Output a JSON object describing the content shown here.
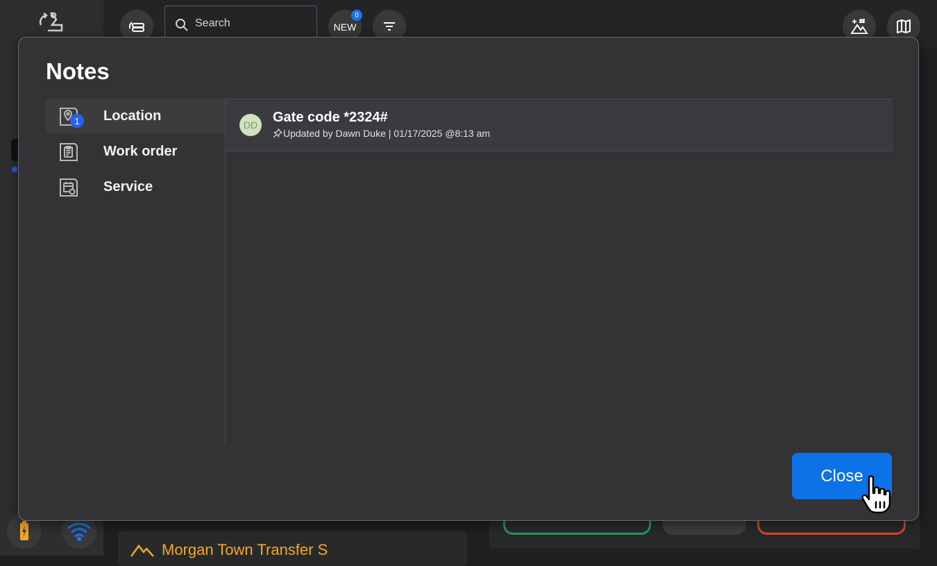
{
  "topbar": {
    "search_placeholder": "Search",
    "new_label": "NEW",
    "new_count": "0"
  },
  "background": {
    "card_title": "Morgan Town Transfer S"
  },
  "modal": {
    "title": "Notes",
    "nav": [
      {
        "label": "Location",
        "icon": "location-note-icon",
        "badge": "1",
        "active": true
      },
      {
        "label": "Work order",
        "icon": "clipboard-note-icon",
        "active": false
      },
      {
        "label": "Service",
        "icon": "calendar-note-icon",
        "active": false
      }
    ],
    "note": {
      "initials": "DD",
      "title": "Gate code *2324#",
      "meta": "Updated by Dawn Duke | 01/17/2025 @8:13 am"
    },
    "close_label": "Close"
  },
  "colors": {
    "accent_blue": "#0b72e7",
    "badge_blue": "#2463eb",
    "warning_orange": "#f6a623",
    "success_green": "#1f9d57",
    "danger_red": "#d9462c"
  }
}
